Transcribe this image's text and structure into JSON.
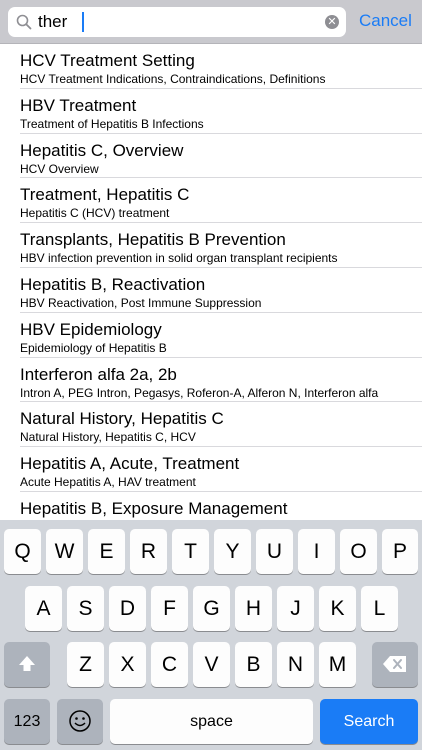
{
  "search": {
    "query": "ther",
    "cancel_label": "Cancel"
  },
  "results": [
    {
      "title": "HCV Treatment Setting",
      "subtitle": "HCV Treatment Indications, Contraindications, Definitions"
    },
    {
      "title": "HBV Treatment",
      "subtitle": "Treatment of Hepatitis B Infections"
    },
    {
      "title": "Hepatitis C, Overview",
      "subtitle": "HCV Overview"
    },
    {
      "title": "Treatment, Hepatitis C",
      "subtitle": "Hepatitis C (HCV) treatment"
    },
    {
      "title": "Transplants, Hepatitis B Prevention",
      "subtitle": "HBV infection prevention in solid organ transplant recipients"
    },
    {
      "title": "Hepatitis B, Reactivation",
      "subtitle": "HBV Reactivation, Post Immune Suppression"
    },
    {
      "title": "HBV Epidemiology",
      "subtitle": "Epidemiology of Hepatitis B"
    },
    {
      "title": "Interferon alfa 2a, 2b",
      "subtitle": "Intron A, PEG Intron, Pegasys, Roferon-A, Alferon N, Interferon alfa"
    },
    {
      "title": "Natural History, Hepatitis C",
      "subtitle": "Natural History, Hepatitis C, HCV"
    },
    {
      "title": "Hepatitis A, Acute, Treatment",
      "subtitle": "Acute Hepatitis A, HAV treatment"
    },
    {
      "title": "Hepatitis B, Exposure Management",
      "subtitle": ""
    }
  ],
  "keyboard": {
    "row1": [
      "Q",
      "W",
      "E",
      "R",
      "T",
      "Y",
      "U",
      "I",
      "O",
      "P"
    ],
    "row2": [
      "A",
      "S",
      "D",
      "F",
      "G",
      "H",
      "J",
      "K",
      "L"
    ],
    "row3": [
      "Z",
      "X",
      "C",
      "V",
      "B",
      "N",
      "M"
    ],
    "numbers_label": "123",
    "space_label": "space",
    "search_label": "Search",
    "shift_icon": "shift-icon",
    "backspace_icon": "backspace-icon",
    "emoji_icon": "emoji-icon"
  }
}
